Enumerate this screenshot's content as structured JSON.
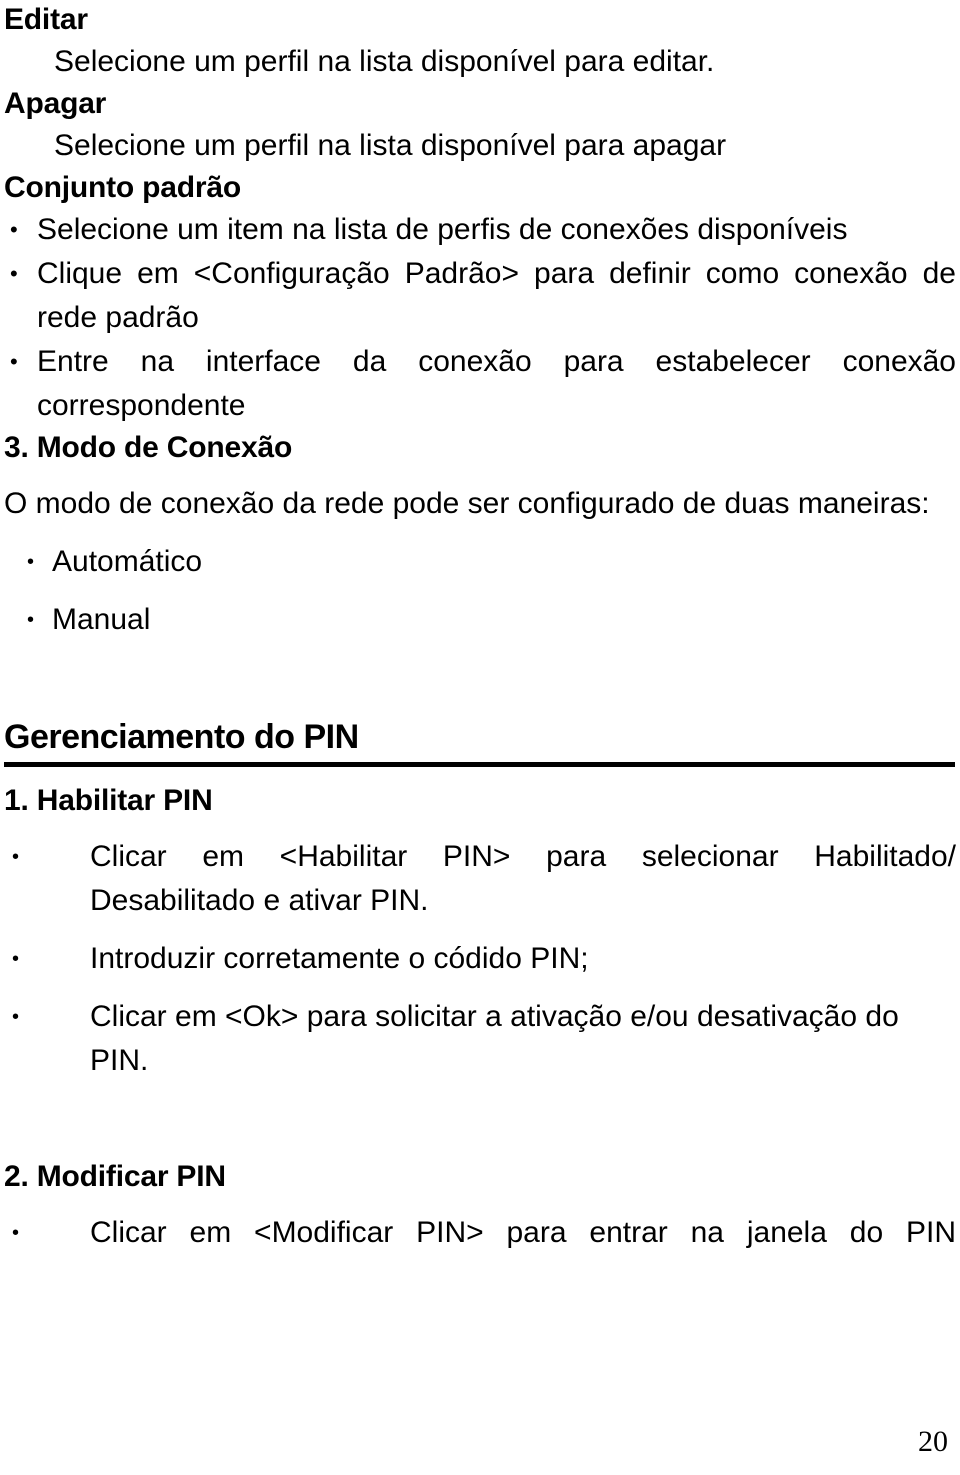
{
  "document": {
    "page_number": "20",
    "sections": [
      {
        "heading": "Editar",
        "body": "Selecione um perfil na lista disponível para editar."
      },
      {
        "heading": "Apagar",
        "body": "Selecione um perfil na lista disponível para apagar"
      },
      {
        "heading": "Conjunto padrão",
        "bullets": [
          "Selecione um item na lista de perfis de conexões disponíveis",
          "Clique em <Configuração Padrão> para definir como conexão de rede padrão",
          "Entre na interface da conexão para estabelecer conexão correspondente"
        ]
      },
      {
        "heading": "3. Modo de Conexão",
        "intro": "O modo de conexão da rede pode ser configurado de duas maneiras:",
        "modes": [
          "Automático",
          "Manual"
        ]
      }
    ],
    "pin_section": {
      "title": "Gerenciamento do PIN",
      "items": [
        {
          "heading": "1. Habilitar PIN",
          "bullets": [
            "Clicar em <Habilitar PIN> para selecionar Habilitado/ Desabilitado e ativar PIN.",
            "Introduzir corretamente o códido PIN;",
            "Clicar em <Ok> para solicitar a ativação e/ou desativação do PIN."
          ]
        },
        {
          "heading": "2. Modificar PIN",
          "bullets": [
            "Clicar em <Modificar PIN> para entrar na janela do PIN"
          ]
        }
      ]
    },
    "bullet_glyph": "•"
  }
}
